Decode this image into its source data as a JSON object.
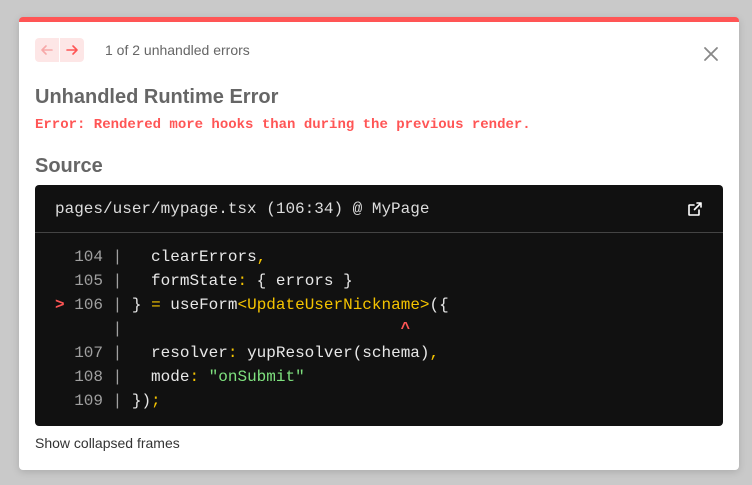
{
  "header": {
    "counter": "1 of 2 unhandled errors",
    "icons": {
      "prev": "arrow-left-icon",
      "next": "arrow-right-icon",
      "close": "close-icon"
    }
  },
  "error": {
    "title": "Unhandled Runtime Error",
    "message": "Error: Rendered more hooks than during the previous render."
  },
  "source": {
    "heading": "Source",
    "file_location": "pages/user/mypage.tsx (106:34) @ MyPage",
    "open_icon": "external-link-icon",
    "lines": [
      {
        "marker": "",
        "number": "104",
        "code": "  clearErrors",
        "suffix": ","
      },
      {
        "marker": "",
        "number": "105",
        "code": "  formState",
        "colon": ":",
        "rest": " { errors }"
      },
      {
        "marker": ">",
        "number": "106",
        "code_a": "} ",
        "eq": "=",
        "code_b": " useForm",
        "type": "<UpdateUserNickname>",
        "code_c": "({"
      },
      {
        "marker": "",
        "number": "",
        "caret": "^"
      },
      {
        "marker": "",
        "number": "107",
        "code": "  resolver",
        "colon": ":",
        "rest": " yupResolver(schema)",
        "suffix": ","
      },
      {
        "marker": "",
        "number": "108",
        "code": "  mode",
        "colon": ":",
        "string": "\"onSubmit\""
      },
      {
        "marker": "",
        "number": "109",
        "code": "})",
        "suffix": ";"
      }
    ]
  },
  "footer": {
    "show_frames": "Show collapsed frames"
  },
  "colors": {
    "accent": "#ff5555",
    "code_bg": "#111111",
    "string": "#7ee07e",
    "punct": "#f5c400"
  }
}
